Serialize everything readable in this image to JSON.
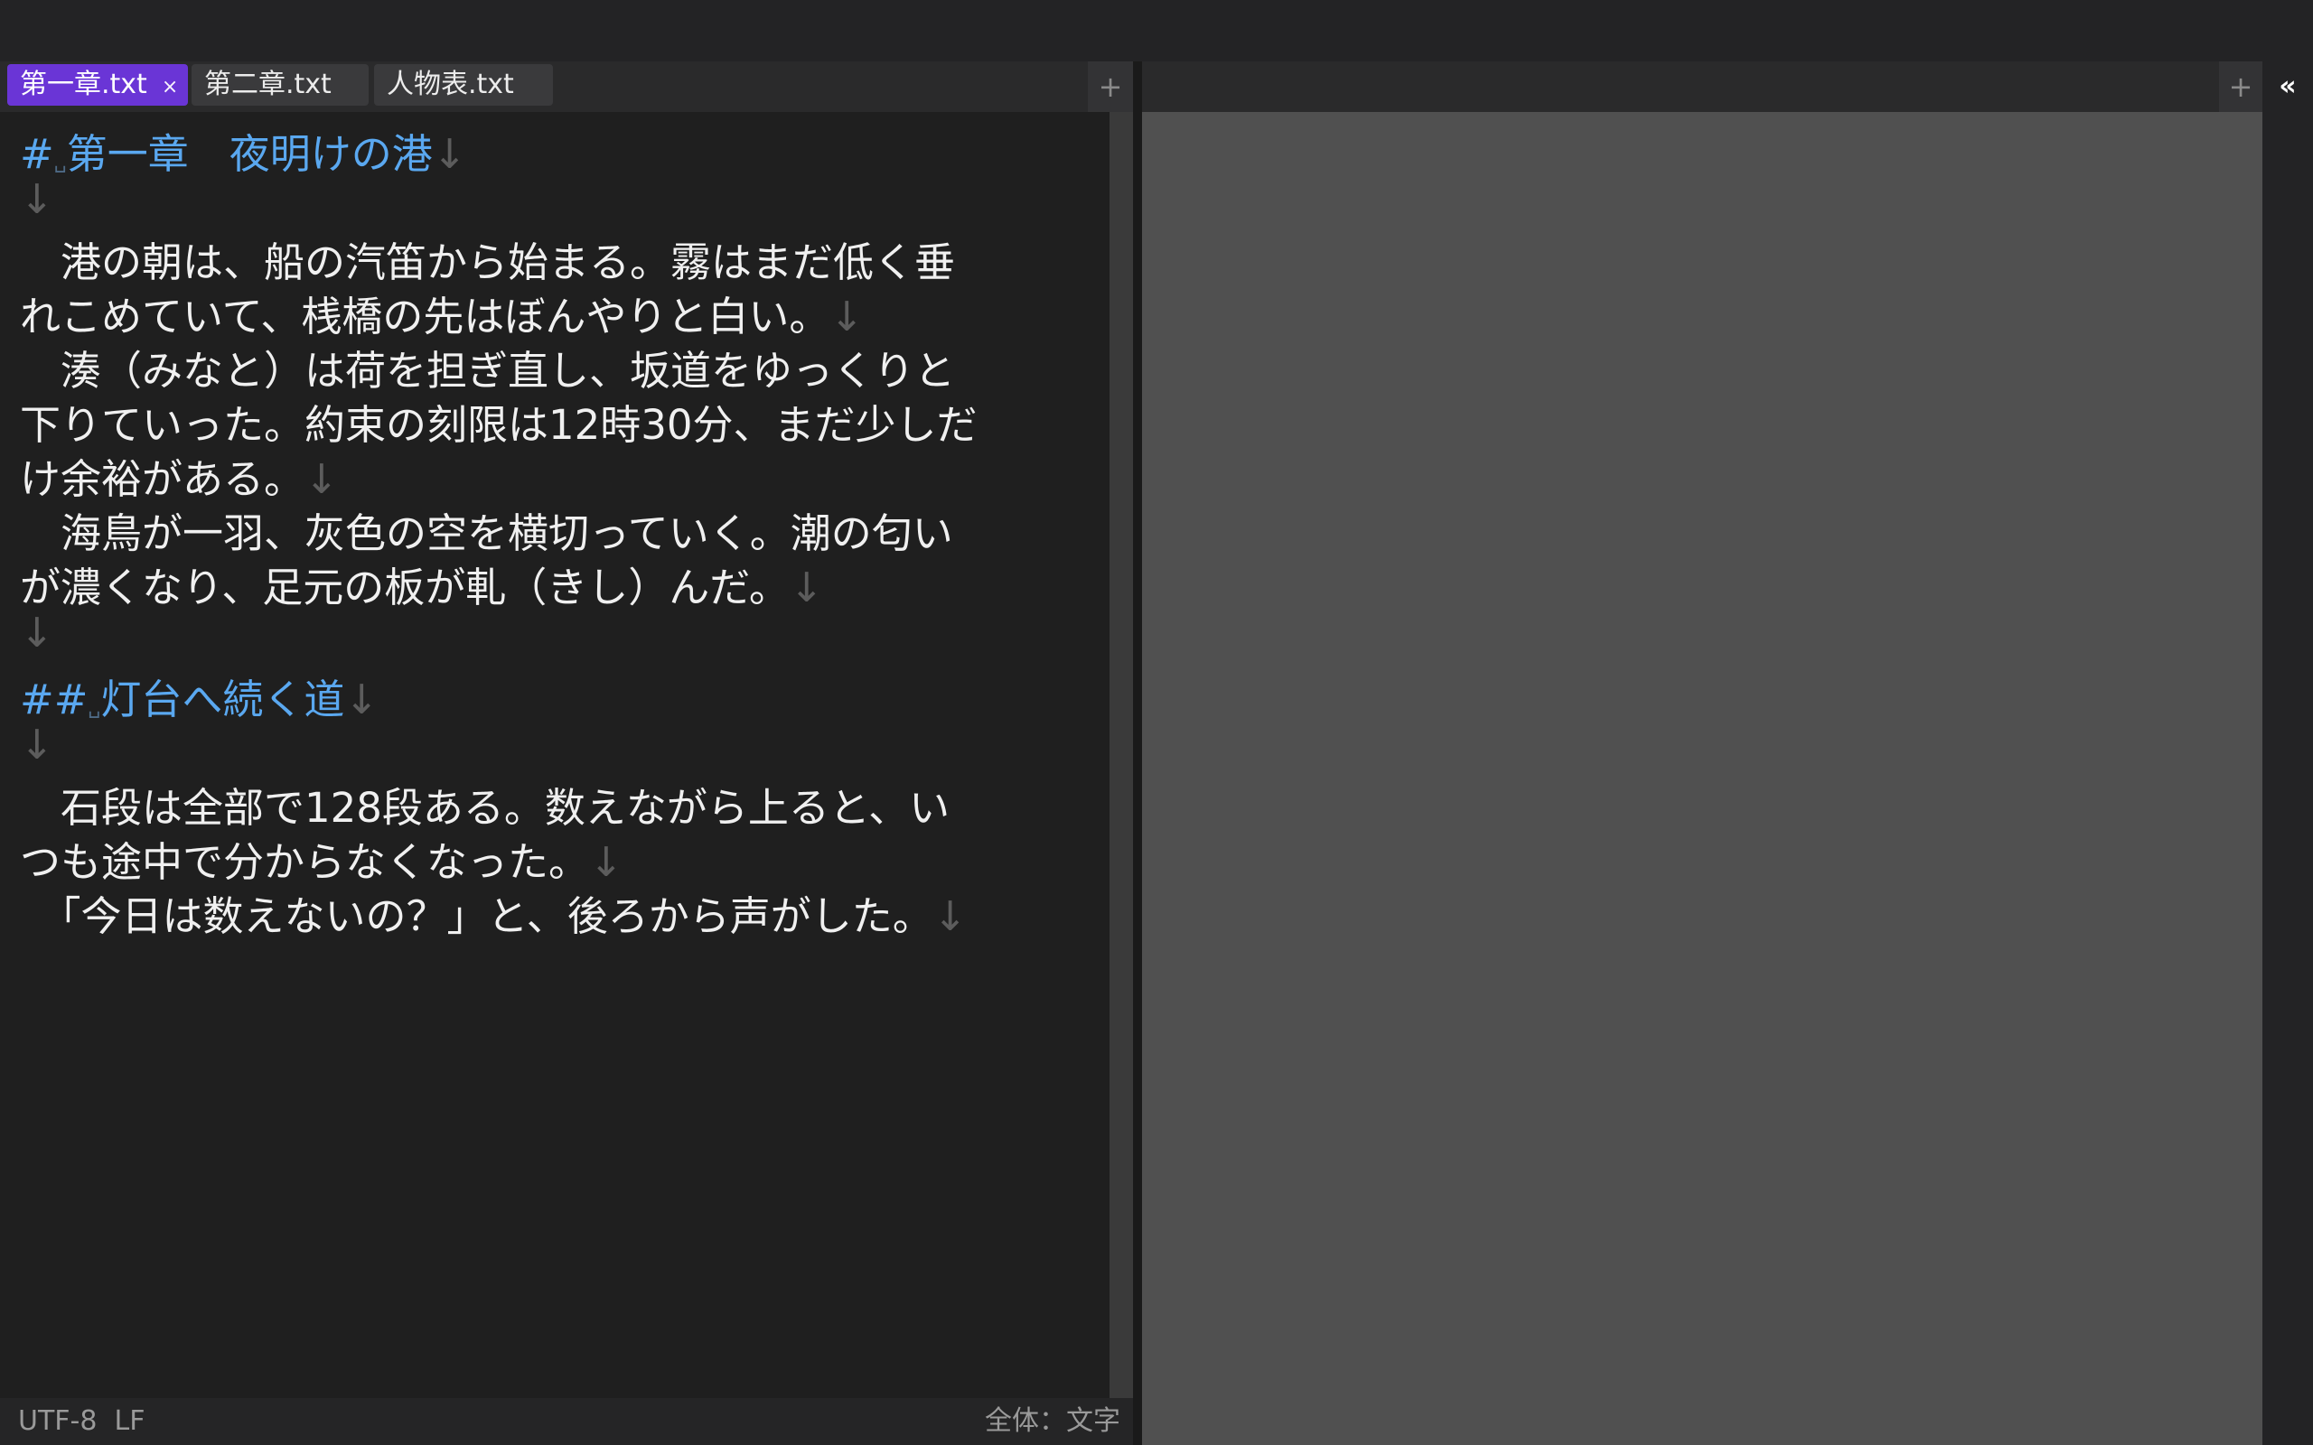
{
  "tabs": [
    {
      "label": "第一章.txt",
      "active": true,
      "close": "×"
    },
    {
      "label": "第二章.txt",
      "active": false
    },
    {
      "label": "人物表.txt",
      "active": false
    }
  ],
  "tab_add": "+",
  "right_add": "+",
  "collapse": "«",
  "newline_mark": "↓",
  "space_mark": "␣",
  "editor": {
    "h1_marker": "#",
    "h1_text": "第一章　夜明けの港",
    "p1a": "　港の朝は、船の汽笛から始まる。霧はまだ低く垂",
    "p1b": "れこめていて、桟橋の先はぼんやりと白い。",
    "p2a": "　湊（みなと）は荷を担ぎ直し、坂道をゆっくりと",
    "p2b": "下りていった。約束の刻限は12時30分、まだ少しだ",
    "p2c": "け余裕がある。",
    "p3a": "　海鳥が一羽、灰色の空を横切っていく。潮の匂い",
    "p3b": "が濃くなり、足元の板が軋（きし）んだ。",
    "h2_marker": "##",
    "h2_text": "灯台へ続く道",
    "p4a": "　石段は全部で128段ある。数えながら上ると、い",
    "p4b": "つも途中で分からなくなった。",
    "p5": "　「今日は数えないの？」と、後ろから声がした。"
  },
  "status": {
    "encoding": "UTF-8",
    "line_ending": "LF",
    "count_label": "全体：",
    "count_unit": "文字"
  },
  "colors": {
    "accent_tab": "#6a35d6",
    "heading": "#5aa8f0",
    "editor_bg": "#1f1f1f",
    "preview_bg": "#505050"
  }
}
